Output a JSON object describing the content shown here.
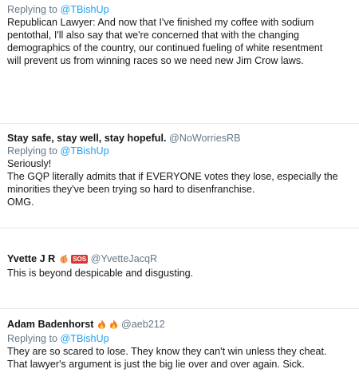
{
  "tweets": [
    {
      "reply_prefix": "Replying to ",
      "reply_handle": "@TBishUp",
      "lines": [
        "Republican Lawyer: And now that I've finished my coffee with sodium",
        "pentothal, I'll also say that we're concerned that with the changing",
        "demographics of the country, our continued fueling of white resentment",
        "will prevent us from winning races so we need new Jim Crow laws."
      ]
    },
    {
      "name": "Stay safe, stay well, stay hopeful.",
      "handle": "@NoWorriesRB",
      "reply_prefix": "Replying to ",
      "reply_handle": "@TBishUp",
      "lines": [
        "Seriously!",
        "The GQP literally admits that if EVERYONE votes they lose, especially the",
        "minorities they've been trying so hard to disenfranchise.",
        "OMG."
      ]
    },
    {
      "name": "Yvette J R",
      "sos_label": "SOS",
      "handle": "@YvetteJacqR",
      "icons": [
        "peach-emoji-icon",
        "sos-icon"
      ],
      "lines": [
        "This is beyond despicable and disgusting."
      ]
    },
    {
      "name": "Adam Badenhorst",
      "handle": "@aeb212",
      "icons": [
        "fire-emoji-icon",
        "fire-emoji-icon"
      ],
      "reply_prefix": "Replying to ",
      "reply_handle": "@TBishUp",
      "lines": [
        "They are so scared to lose. They know they can't win unless they cheat.",
        "That lawyer's argument is just the big lie over and over again. Sick."
      ]
    }
  ],
  "colors": {
    "text": "#14171a",
    "secondary": "#657786",
    "link": "#1da1f2",
    "divider": "#e1e8ed"
  }
}
